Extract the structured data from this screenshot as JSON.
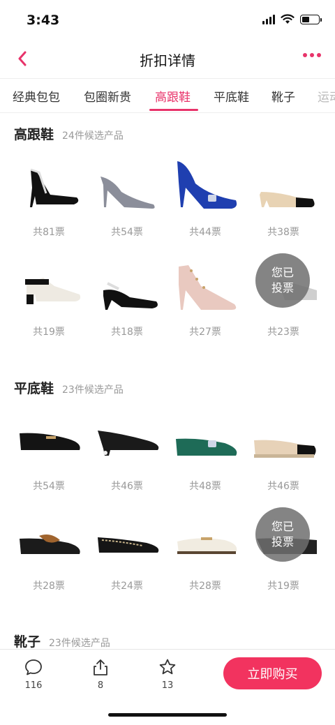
{
  "status_bar": {
    "time": "3:43"
  },
  "nav": {
    "title": "折扣详情"
  },
  "tabs": [
    {
      "label": "经典包包"
    },
    {
      "label": "包圈新贵"
    },
    {
      "label": "高跟鞋"
    },
    {
      "label": "平底鞋"
    },
    {
      "label": "靴子"
    },
    {
      "label": "运动"
    }
  ],
  "sections": [
    {
      "title": "高跟鞋",
      "subtitle": "24件候选产品",
      "products": [
        {
          "votes": "共81票",
          "color": "#111111"
        },
        {
          "votes": "共54票",
          "color": "#8b8e9a"
        },
        {
          "votes": "共44票",
          "color": "#1f3fb0"
        },
        {
          "votes": "共38票",
          "color": "#e8d3b4"
        },
        {
          "votes": "共19票",
          "color": "#eeeae2"
        },
        {
          "votes": "共18票",
          "color": "#111111"
        },
        {
          "votes": "共27票",
          "color": "#e9c9c0"
        },
        {
          "votes": "共23票",
          "color": "#cfcfcf",
          "voted": "您已投票"
        }
      ]
    },
    {
      "title": "平底鞋",
      "subtitle": "23件候选产品",
      "products": [
        {
          "votes": "共54票",
          "color": "#141414"
        },
        {
          "votes": "共46票",
          "color": "#1a1a1a"
        },
        {
          "votes": "共48票",
          "color": "#1e6b57"
        },
        {
          "votes": "共46票",
          "color": "#e7d2b8"
        },
        {
          "votes": "共28票",
          "color": "#1b1b1b"
        },
        {
          "votes": "共24票",
          "color": "#151515"
        },
        {
          "votes": "共28票",
          "color": "#f1ece1"
        },
        {
          "votes": "共19票",
          "color": "#222222",
          "voted": "您已投票"
        }
      ]
    },
    {
      "title": "靴子",
      "subtitle": "23件候选产品"
    }
  ],
  "bottom": {
    "comments": "116",
    "shares": "8",
    "favorites": "13",
    "buy_label": "立即购买"
  },
  "colors": {
    "accent": "#e8336a",
    "buy_button": "#f2335f"
  }
}
